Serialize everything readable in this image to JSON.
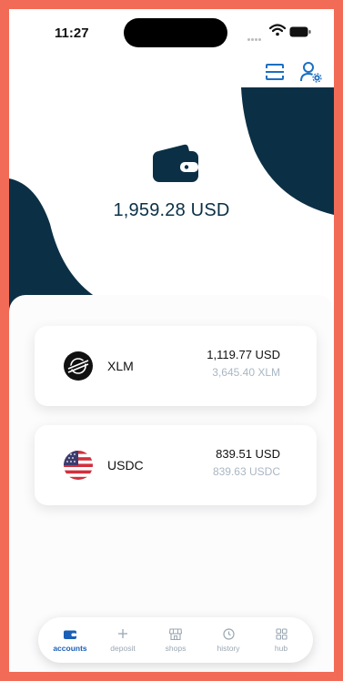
{
  "status_bar": {
    "time": "11:27"
  },
  "balance": {
    "total": "1,959.28 USD"
  },
  "accounts": [
    {
      "name": "XLM",
      "fiat_value": "1,119.77 USD",
      "crypto_value": "3,645.40 XLM",
      "icon": "stellar-icon"
    },
    {
      "name": "USDC",
      "fiat_value": "839.51 USD",
      "crypto_value": "839.63 USDC",
      "icon": "us-flag-icon"
    }
  ],
  "bottom_nav": [
    {
      "label": "accounts",
      "icon": "wallet-icon",
      "active": true
    },
    {
      "label": "deposit",
      "icon": "plus-icon",
      "active": false
    },
    {
      "label": "shops",
      "icon": "storefront-icon",
      "active": false
    },
    {
      "label": "history",
      "icon": "clock-icon",
      "active": false
    },
    {
      "label": "hub",
      "icon": "grid-icon",
      "active": false
    }
  ],
  "colors": {
    "frame": "#f26b56",
    "navy": "#0b3046",
    "accent_blue": "#1b5fb7",
    "muted_text": "#a9b7c3"
  }
}
